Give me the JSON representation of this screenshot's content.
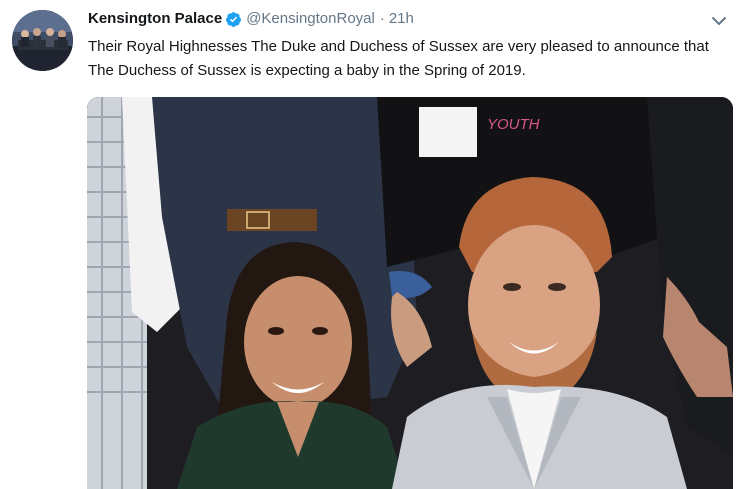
{
  "tweet": {
    "author_name": "Kensington Palace",
    "handle": "@KensingtonRoyal",
    "separator": "·",
    "time": "21h",
    "text": "Their Royal Highnesses The Duke and Duchess of Sussex are very pleased to announce that The Duchess of Sussex is expecting a baby in the Spring of 2019.",
    "badge_text": "YOUTH"
  },
  "icons": {
    "verified": "verified-badge-icon",
    "menu": "chevron-down-icon"
  },
  "colors": {
    "text_primary": "#14171a",
    "text_secondary": "#657786",
    "verified_blue": "#1da1f2",
    "photo_coat_green": "#1f3a2c",
    "photo_jacket_grey": "#c9cdd3"
  }
}
